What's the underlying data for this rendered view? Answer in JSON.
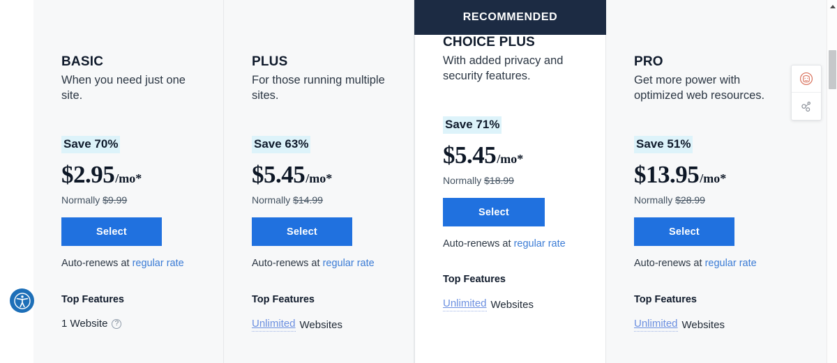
{
  "theme": {
    "page_bg": "#ffffff",
    "card_bg": "#f7f8f9",
    "featured_bg": "#ffffff",
    "ribbon_bg": "#1c2b43",
    "accent_blue": "#2071df",
    "link_blue": "#3a7bd5",
    "save_badge_bg": "#ddf3fa",
    "a11y_blue": "#1d6fb8"
  },
  "plans": [
    {
      "name": "BASIC",
      "tagline": "When you need just one site.",
      "recommended": false,
      "ribbon_label": "",
      "save_label": "Save 70%",
      "price_amount": "$2.95",
      "price_period": "/mo*",
      "normally_prefix": "Normally ",
      "normally_price": "$9.99",
      "select_label": "Select",
      "autorenew_prefix": "Auto-renews at ",
      "autorenew_link": "regular rate",
      "features_heading": "Top Features",
      "feature_link": "",
      "feature_text": "1 Website",
      "feature_help_icon": "question-mark-icon",
      "has_help_icon": true
    },
    {
      "name": "PLUS",
      "tagline": "For those running multiple sites.",
      "recommended": false,
      "ribbon_label": "",
      "save_label": "Save 63%",
      "price_amount": "$5.45",
      "price_period": "/mo*",
      "normally_prefix": "Normally ",
      "normally_price": "$14.99",
      "select_label": "Select",
      "autorenew_prefix": "Auto-renews at ",
      "autorenew_link": "regular rate",
      "features_heading": "Top Features",
      "feature_link": "Unlimited",
      "feature_text": "Websites",
      "feature_help_icon": "",
      "has_help_icon": false
    },
    {
      "name": "CHOICE PLUS",
      "tagline": "With added privacy and security features.",
      "recommended": true,
      "ribbon_label": "RECOMMENDED",
      "save_label": "Save 71%",
      "price_amount": "$5.45",
      "price_period": "/mo*",
      "normally_prefix": "Normally ",
      "normally_price": "$18.99",
      "select_label": "Select",
      "autorenew_prefix": "Auto-renews at ",
      "autorenew_link": "regular rate",
      "features_heading": "Top Features",
      "feature_link": "Unlimited",
      "feature_text": "Websites",
      "feature_help_icon": "",
      "has_help_icon": false
    },
    {
      "name": "PRO",
      "tagline": "Get more power with optimized web resources.",
      "recommended": false,
      "ribbon_label": "",
      "save_label": "Save 51%",
      "price_amount": "$13.95",
      "price_period": "/mo*",
      "normally_prefix": "Normally ",
      "normally_price": "$28.99",
      "select_label": "Select",
      "autorenew_prefix": "Auto-renews at ",
      "autorenew_link": "regular rate",
      "features_heading": "Top Features",
      "feature_link": "Unlimited",
      "feature_text": "Websites",
      "feature_help_icon": "",
      "has_help_icon": false
    }
  ],
  "accessibility_widget": {
    "icon": "accessibility-person-icon"
  },
  "side_widget": {
    "items": [
      {
        "icon": "face-avatar-icon",
        "color": "#d9705b"
      },
      {
        "icon": "share-nodes-icon",
        "color": "#8a8f98"
      }
    ]
  },
  "scrollbar": {
    "up_arrow_icon": "scroll-up-arrow-icon",
    "thumb_icon": "scrollbar-thumb"
  }
}
